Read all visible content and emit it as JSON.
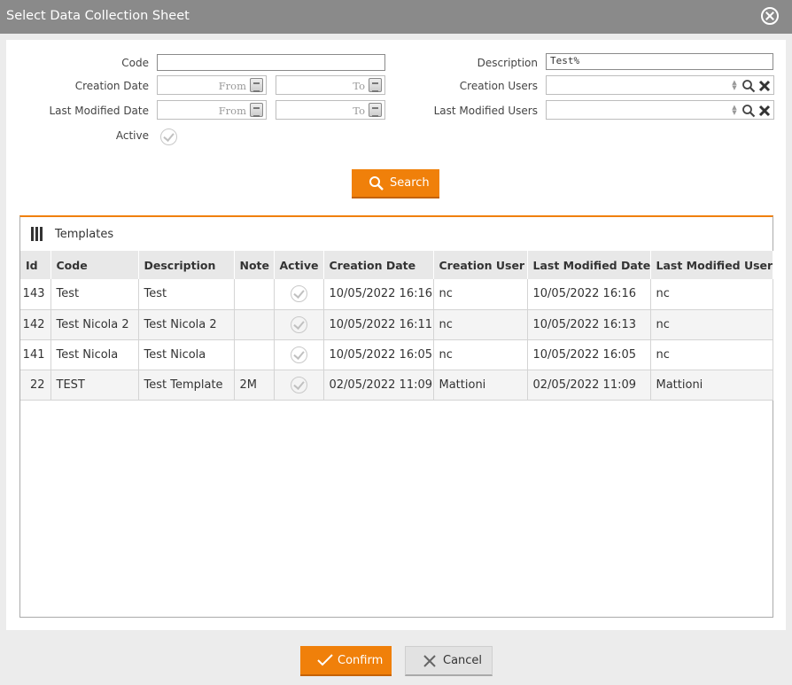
{
  "dialog": {
    "title": "Select Data Collection Sheet"
  },
  "filters": {
    "code_label": "Code",
    "code_value": "",
    "description_label": "Description",
    "description_value": "Test%",
    "creation_date_label": "Creation Date",
    "last_modified_date_label": "Last Modified Date",
    "from_placeholder": "From",
    "to_placeholder": "To",
    "creation_users_label": "Creation Users",
    "last_modified_users_label": "Last Modified Users",
    "active_label": "Active",
    "search_label": "Search"
  },
  "templates": {
    "title": "Templates",
    "columns": [
      "Id",
      "Code",
      "Description",
      "Note",
      "Active",
      "Creation Date",
      "Creation User",
      "Last Modified Date",
      "Last Modified User"
    ],
    "rows": [
      {
        "id": "143",
        "code": "Test",
        "description": "Test",
        "note": "",
        "active": true,
        "creation_date": "10/05/2022 16:16",
        "creation_user": "nc",
        "last_modified_date": "10/05/2022 16:16",
        "last_modified_user": "nc"
      },
      {
        "id": "142",
        "code": "Test Nicola 2",
        "description": "Test Nicola 2",
        "note": "",
        "active": true,
        "creation_date": "10/05/2022 16:11",
        "creation_user": "nc",
        "last_modified_date": "10/05/2022 16:13",
        "last_modified_user": "nc"
      },
      {
        "id": "141",
        "code": "Test Nicola",
        "description": "Test Nicola",
        "note": "",
        "active": true,
        "creation_date": "10/05/2022 16:05",
        "creation_user": "nc",
        "last_modified_date": "10/05/2022 16:05",
        "last_modified_user": "nc"
      },
      {
        "id": "22",
        "code": "TEST",
        "description": "Test Template",
        "note": "2M",
        "active": true,
        "creation_date": "02/05/2022 11:09",
        "creation_user": "Mattioni",
        "last_modified_date": "02/05/2022 11:09",
        "last_modified_user": "Mattioni"
      }
    ]
  },
  "footer": {
    "confirm_label": "Confirm",
    "cancel_label": "Cancel"
  },
  "colors": {
    "accent": "#f0800a",
    "titlebar": "#8a8a8a"
  }
}
